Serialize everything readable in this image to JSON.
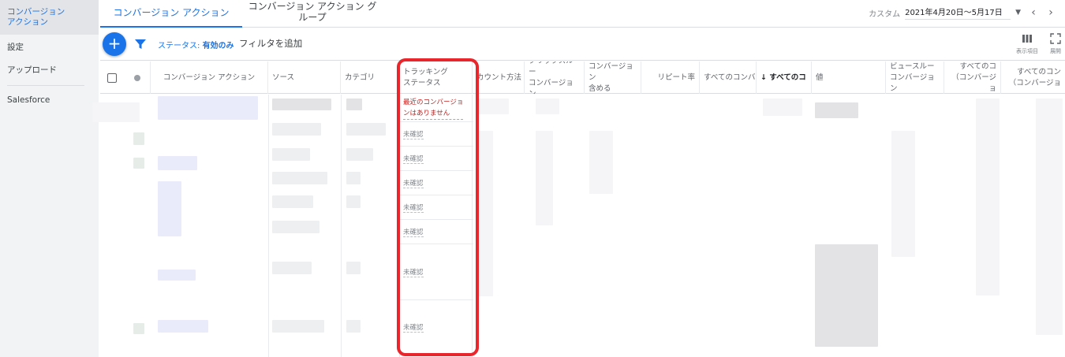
{
  "sidebar": {
    "items": [
      {
        "label": "コンバージョン\nアクション"
      },
      {
        "label": "設定"
      },
      {
        "label": "アップロード"
      },
      {
        "label": "Salesforce"
      }
    ]
  },
  "tabs": [
    {
      "label": "コンバージョン アクション"
    },
    {
      "label": "コンバージョン アクション グループ"
    }
  ],
  "date": {
    "custom_label": "カスタム",
    "range": "2021年4月20日～5月17日"
  },
  "toolbar": {
    "add_label": "+",
    "status_prefix": "ステータス: ",
    "status_value": "有効のみ",
    "add_filter": "フィルタを追加",
    "columns_label": "表示項目",
    "expand_label": "展開"
  },
  "table": {
    "headers": [
      "コンバージョン アクション",
      "ソース",
      "カテゴリ",
      "トラッキング\nステータス",
      "カウント方法",
      "クリックスルー\nコンバージョン",
      "コンバージョン\n含める",
      "リピート率",
      "すべてのコンバ",
      "↓ すべてのコ",
      "値",
      "ビュースルー\nコンバージョン",
      "すべてのコ\n（コンバージョ",
      "すべてのコン\n（コンバージョ"
    ],
    "tracking_status": [
      "最近のコンバージョ\nンはありません",
      "未確認",
      "未確認",
      "未確認",
      "未確認",
      "未確認",
      "未確認",
      "未確認"
    ]
  },
  "colors": {
    "accent": "#1a73e8",
    "highlight": "#e8262b",
    "warning": "#c5221f"
  }
}
